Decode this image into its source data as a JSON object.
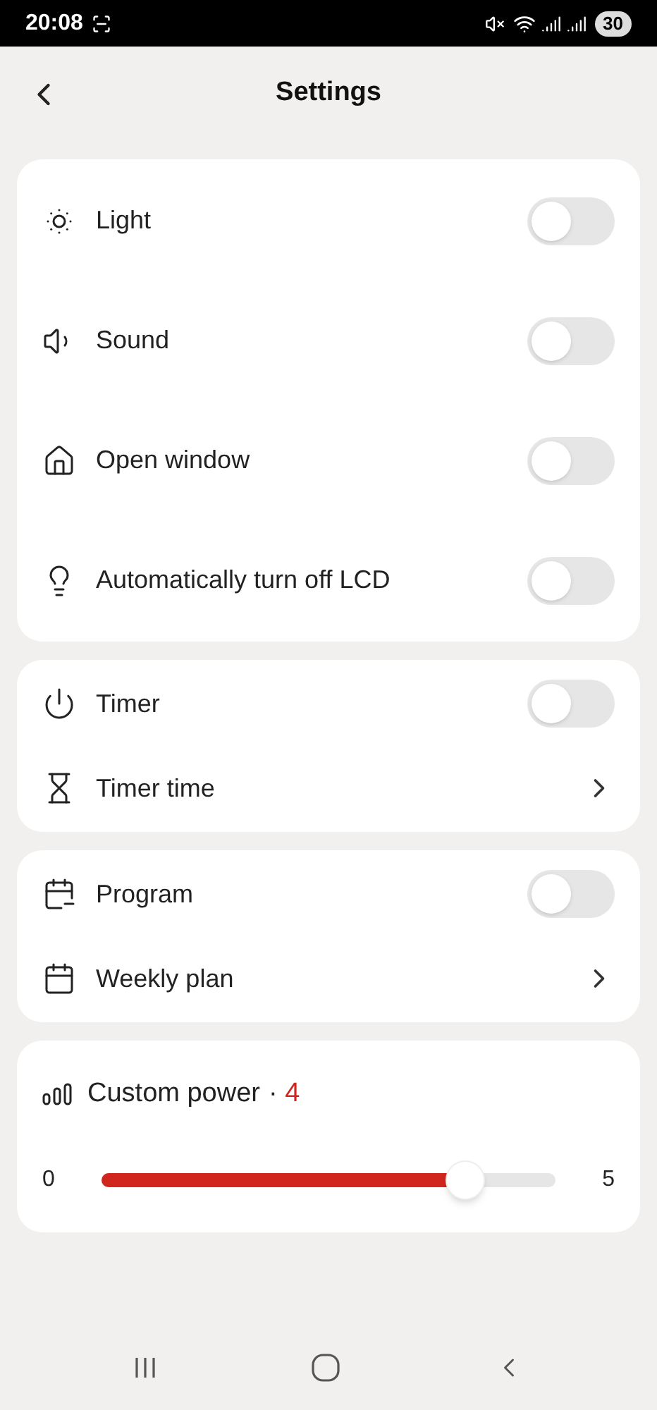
{
  "status_bar": {
    "time": "20:08",
    "battery": "30"
  },
  "header": {
    "title": "Settings"
  },
  "groups": [
    {
      "items": [
        {
          "kind": "toggle",
          "label": "Light",
          "on": false
        },
        {
          "kind": "toggle",
          "label": "Sound",
          "on": false
        },
        {
          "kind": "toggle",
          "label": "Open window",
          "on": false
        },
        {
          "kind": "toggle",
          "label": "Automatically turn off LCD",
          "on": false
        }
      ]
    },
    {
      "items": [
        {
          "kind": "toggle",
          "label": "Timer",
          "on": false
        },
        {
          "kind": "link",
          "label": "Timer time"
        }
      ]
    },
    {
      "items": [
        {
          "kind": "toggle",
          "label": "Program",
          "on": false
        },
        {
          "kind": "link",
          "label": "Weekly plan"
        }
      ]
    }
  ],
  "power": {
    "label": "Custom power",
    "separator": "·",
    "value": "4",
    "min": "0",
    "max": "5",
    "level": 0.8
  }
}
